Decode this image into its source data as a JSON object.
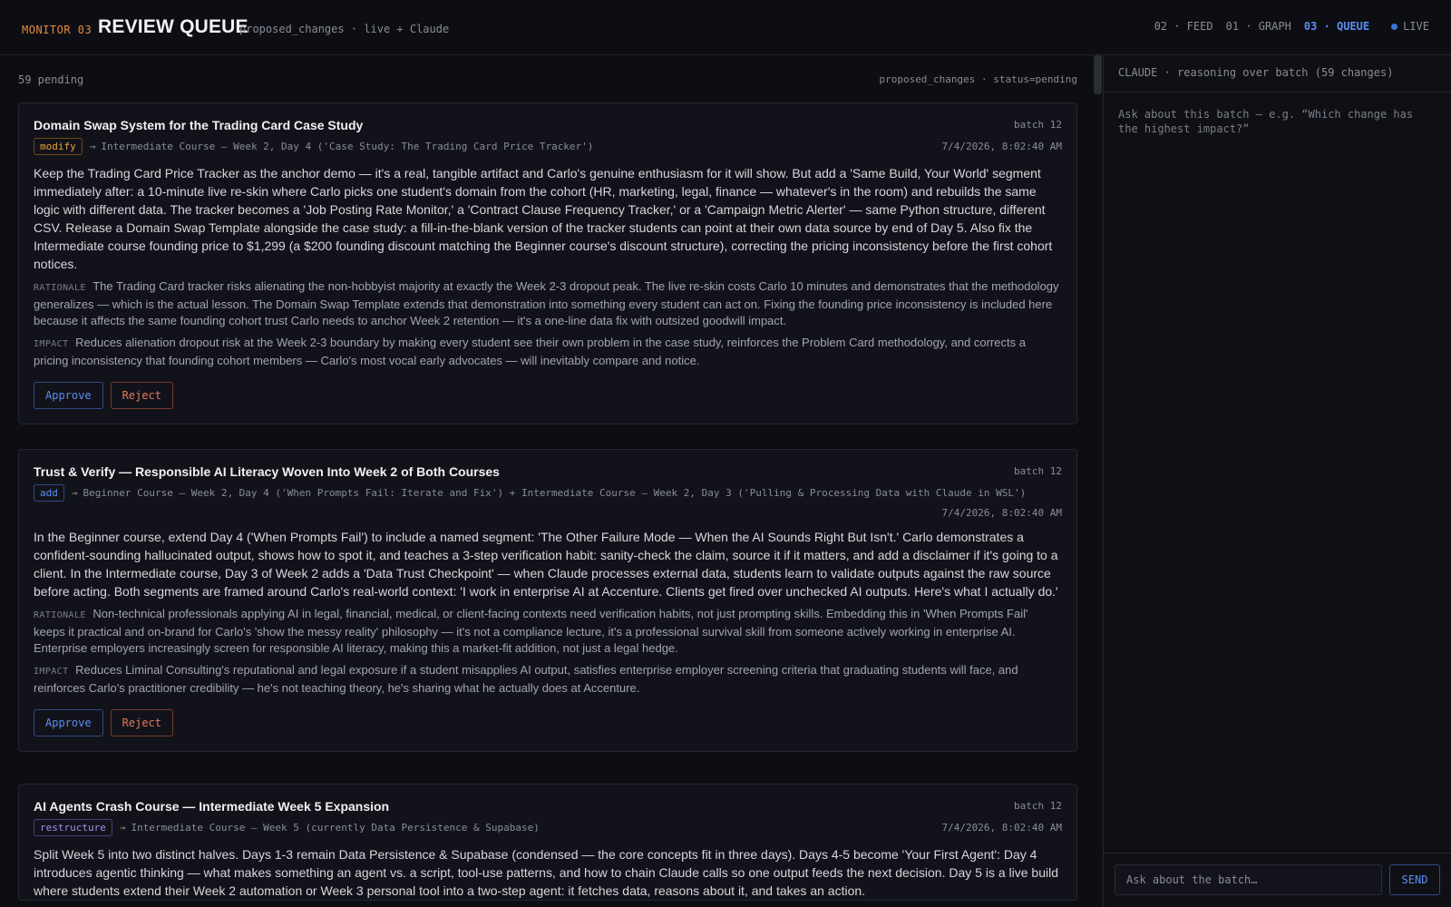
{
  "header": {
    "brand": "MONITOR 03",
    "title": "REVIEW QUEUE",
    "subtitle": "proposed_changes · live + Claude",
    "nav": [
      {
        "label": "02 · FEED",
        "active": false
      },
      {
        "label": "01 · GRAPH",
        "active": false
      },
      {
        "label": "03 · QUEUE",
        "active": true
      }
    ],
    "live_label": "LIVE"
  },
  "main": {
    "pending_count": "59 pending",
    "filter": "proposed_changes · status=pending",
    "section_labels": {
      "rationale": "RATIONALE",
      "impact": "IMPACT"
    },
    "buttons": {
      "approve": "Approve",
      "reject": "Reject"
    },
    "cards": [
      {
        "title": "Domain Swap System for the Trading Card Case Study",
        "batch": "batch 12",
        "type": "modify",
        "target": "Intermediate Course — Week 2, Day 4 ('Case Study: The Trading Card Price Tracker')",
        "date": "7/4/2026, 8:02:40 AM",
        "body": "Keep the Trading Card Price Tracker as the anchor demo — it's a real, tangible artifact and Carlo's genuine enthusiasm for it will show. But add a 'Same Build, Your World' segment immediately after: a 10-minute live re-skin where Carlo picks one student's domain from the cohort (HR, marketing, legal, finance — whatever's in the room) and rebuilds the same logic with different data. The tracker becomes a 'Job Posting Rate Monitor,' a 'Contract Clause Frequency Tracker,' or a 'Campaign Metric Alerter' — same Python structure, different CSV. Release a Domain Swap Template alongside the case study: a fill-in-the-blank version of the tracker students can point at their own data source by end of Day 5. Also fix the Intermediate course founding price to $1,299 (a $200 founding discount matching the Beginner course's discount structure), correcting the pricing inconsistency before the first cohort notices.",
        "rationale": "The Trading Card tracker risks alienating the non-hobbyist majority at exactly the Week 2-3 dropout peak. The live re-skin costs Carlo 10 minutes and demonstrates that the methodology generalizes — which is the actual lesson. The Domain Swap Template extends that demonstration into something every student can act on. Fixing the founding price inconsistency is included here because it affects the same founding cohort trust Carlo needs to anchor Week 2 retention — it's a one-line data fix with outsized goodwill impact.",
        "impact": "Reduces alienation dropout risk at the Week 2-3 boundary by making every student see their own problem in the case study, reinforces the Problem Card methodology, and corrects a pricing inconsistency that founding cohort members — Carlo's most vocal early advocates — will inevitably compare and notice."
      },
      {
        "title": "Trust & Verify — Responsible AI Literacy Woven Into Week 2 of Both Courses",
        "batch": "batch 12",
        "type": "add",
        "target": "Beginner Course — Week 2, Day 4 ('When Prompts Fail: Iterate and Fix') + Intermediate Course — Week 2, Day 3 ('Pulling & Processing Data with Claude in WSL')",
        "date": "7/4/2026, 8:02:40 AM",
        "body": "In the Beginner course, extend Day 4 ('When Prompts Fail') to include a named segment: 'The Other Failure Mode — When the AI Sounds Right But Isn't.' Carlo demonstrates a confident-sounding hallucinated output, shows how to spot it, and teaches a 3-step verification habit: sanity-check the claim, source it if it matters, and add a disclaimer if it's going to a client. In the Intermediate course, Day 3 of Week 2 adds a 'Data Trust Checkpoint' — when Claude processes external data, students learn to validate outputs against the raw source before acting. Both segments are framed around Carlo's real-world context: 'I work in enterprise AI at Accenture. Clients get fired over unchecked AI outputs. Here's what I actually do.'",
        "rationale": "Non-technical professionals applying AI in legal, financial, medical, or client-facing contexts need verification habits, not just prompting skills. Embedding this in 'When Prompts Fail' keeps it practical and on-brand for Carlo's 'show the messy reality' philosophy — it's not a compliance lecture, it's a professional survival skill from someone actively working in enterprise AI. Enterprise employers increasingly screen for responsible AI literacy, making this a market-fit addition, not just a legal hedge.",
        "impact": "Reduces Liminal Consulting's reputational and legal exposure if a student misapplies AI output, satisfies enterprise employer screening criteria that graduating students will face, and reinforces Carlo's practitioner credibility — he's not teaching theory, he's sharing what he actually does at Accenture."
      },
      {
        "title": "AI Agents Crash Course — Intermediate Week 5 Expansion",
        "batch": "batch 12",
        "type": "restructure",
        "target": "Intermediate Course — Week 5 (currently Data Persistence & Supabase)",
        "date": "7/4/2026, 8:02:40 AM",
        "body": "Split Week 5 into two distinct halves. Days 1-3 remain Data Persistence & Supabase (condensed — the core concepts fit in three days). Days 4-5 become 'Your First Agent': Day 4 introduces agentic thinking — what makes something an agent vs. a script, tool-use patterns, and how to chain Claude calls so one output feeds the next decision. Day 5 is a live build where students extend their Week 2 automation or Week 3 personal tool into a two-step agent: it fetches data, reasons about it, and takes an action."
      }
    ]
  },
  "side": {
    "header": "CLAUDE · reasoning over batch (59 changes)",
    "hint": "Ask about this batch — e.g. “Which change has the highest impact?”",
    "input_placeholder": "Ask about the batch…",
    "send_label": "SEND"
  }
}
